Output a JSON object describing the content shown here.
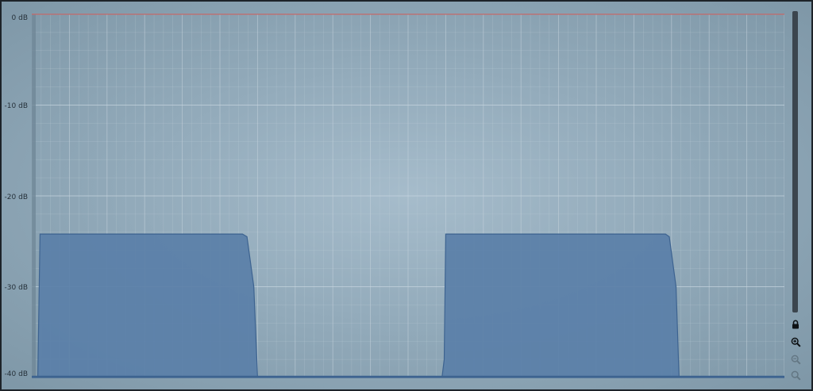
{
  "axis": {
    "y_labels": [
      "0 dB",
      "-10 dB",
      "-20 dB",
      "-30 dB",
      "-40 dB"
    ]
  },
  "colors": {
    "background": "#93abbb",
    "fill": "#5a7fa8",
    "fill_stroke": "#3d6390",
    "zero_line": "#c46a6a",
    "grid": "#c8d6df"
  },
  "icons": [
    "lock-icon",
    "zoom-in-icon",
    "zoom-out-icon",
    "zoom-reset-icon"
  ],
  "chart_data": {
    "type": "area",
    "ylim": [
      -40,
      0
    ],
    "xlim": [
      0,
      100
    ],
    "y_ticks": [
      0,
      -10,
      -20,
      -30,
      -40
    ],
    "grid": true,
    "reference_line_y": 0,
    "x": [
      0,
      0.8,
      1.1,
      28.0,
      28.6,
      29.5,
      30.0,
      54.5,
      54.8,
      55.0,
      84.2,
      84.7,
      85.6,
      86.0,
      100
    ],
    "y": [
      -40,
      -40,
      -24.2,
      -24.2,
      -24.5,
      -30.0,
      -40,
      -40,
      -38.0,
      -24.2,
      -24.2,
      -24.5,
      -30.0,
      -40,
      -40
    ]
  }
}
